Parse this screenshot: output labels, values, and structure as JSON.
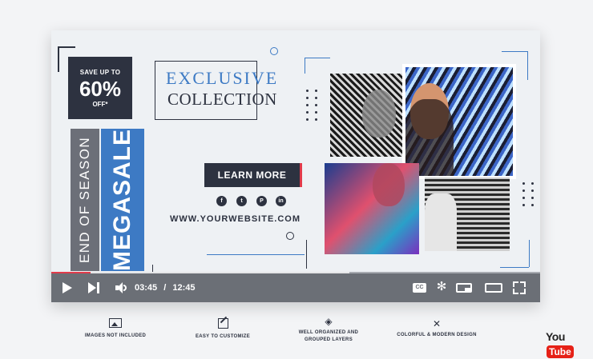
{
  "discount": {
    "top": "SAVE UP TO",
    "value": "60%",
    "off": "OFF*"
  },
  "season_text": "END OF SEASON",
  "megasale_text": "MEGASALE",
  "exclusive": {
    "line1": "EXCLUSIVE",
    "line2": "COLLECTION"
  },
  "cta": {
    "label": "LEARN MORE"
  },
  "social": [
    {
      "icon": "facebook-icon",
      "glyph": "f"
    },
    {
      "icon": "twitter-icon",
      "glyph": "t"
    },
    {
      "icon": "pinterest-icon",
      "glyph": "P"
    },
    {
      "icon": "linkedin-icon",
      "glyph": "in"
    }
  ],
  "website": "WWW.YOURWEBSITE.COM",
  "player": {
    "current_time": "03:45",
    "separator": "/",
    "duration": "12:45",
    "progress_played": 0.08,
    "progress_buffered": 0.61,
    "cc_label": "CC"
  },
  "features": [
    {
      "icon": "image-icon",
      "label": "IMAGES NOT INCLUDED"
    },
    {
      "icon": "edit-icon",
      "label": "EASY TO CUSTOMIZE"
    },
    {
      "icon": "layers-icon",
      "label": "WELL ORGANIZED AND GROUPED LAYERS"
    },
    {
      "icon": "design-tools-icon",
      "label": "COLORFUL & MODERN DESIGN"
    }
  ],
  "brand": {
    "you": "You",
    "tube": "Tube"
  },
  "colors": {
    "navy": "#2d3240",
    "blue": "#3d7ac4",
    "red": "#e23b4a",
    "gray": "#6c6f78"
  }
}
